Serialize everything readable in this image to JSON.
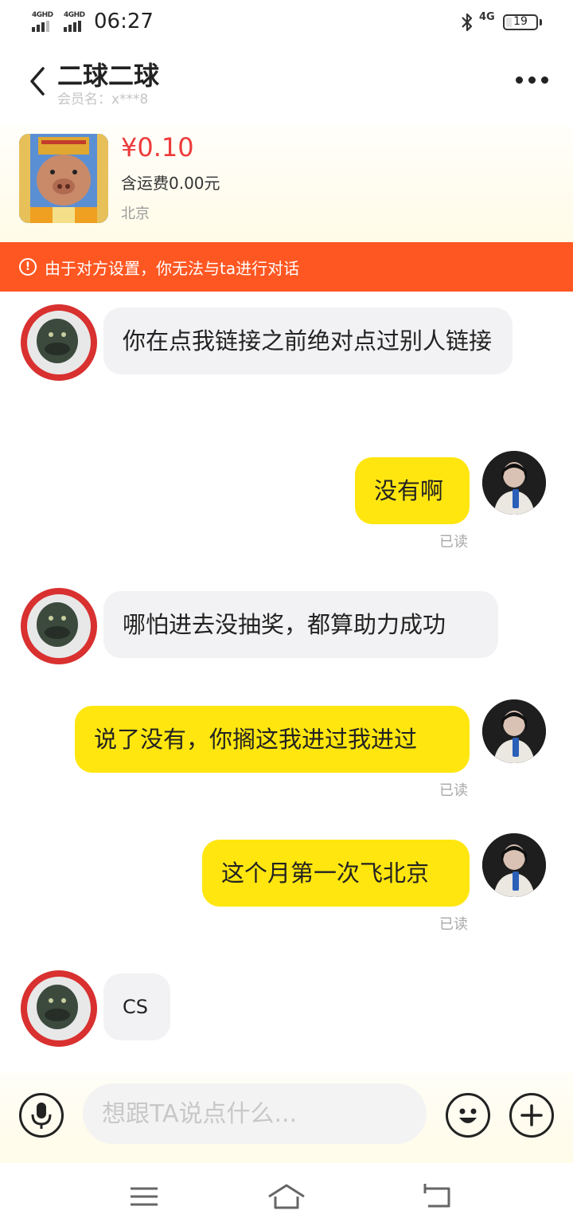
{
  "status_bar": {
    "sim1_label": "4GHD",
    "sim2_label": "4GHD",
    "time": "06:27",
    "network": "4G",
    "battery": "19",
    "battery_level": 0.19
  },
  "header": {
    "back_icon": "chevron-left-icon",
    "title": "二球二球",
    "member_label": "会员名：x***8",
    "more_icon": "more-dots-icon"
  },
  "product": {
    "price": "¥0.10",
    "shipping": "含运费0.00元",
    "location": "北京"
  },
  "banner": {
    "icon": "alert-circle-icon",
    "text": "由于对方设置，你无法与ta进行对话",
    "color": "#ff5722"
  },
  "messages": [
    {
      "side": "in",
      "text": "你在点我链接之前绝对点过别人链接"
    },
    {
      "side": "out",
      "text": "没有啊",
      "status": "已读"
    },
    {
      "side": "in",
      "text": "哪怕进去没抽奖，都算助力成功"
    },
    {
      "side": "out",
      "text": "说了没有，你搁这我进过我进过",
      "status": "已读"
    },
    {
      "side": "out",
      "text": "这个月第一次飞北京",
      "status": "已读"
    },
    {
      "side": "in",
      "text": "CS"
    }
  ],
  "input": {
    "placeholder": "想跟TA说点什么...",
    "mic_icon": "microphone-icon",
    "emoji_icon": "emoji-icon",
    "plus_icon": "plus-icon"
  },
  "nav": {
    "menu_icon": "menu-icon",
    "home_icon": "home-icon",
    "back_icon": "back-icon"
  },
  "colors": {
    "bubble_out": "#ffe60f",
    "bubble_in": "#f2f2f4",
    "price": "#ee3b3b"
  }
}
